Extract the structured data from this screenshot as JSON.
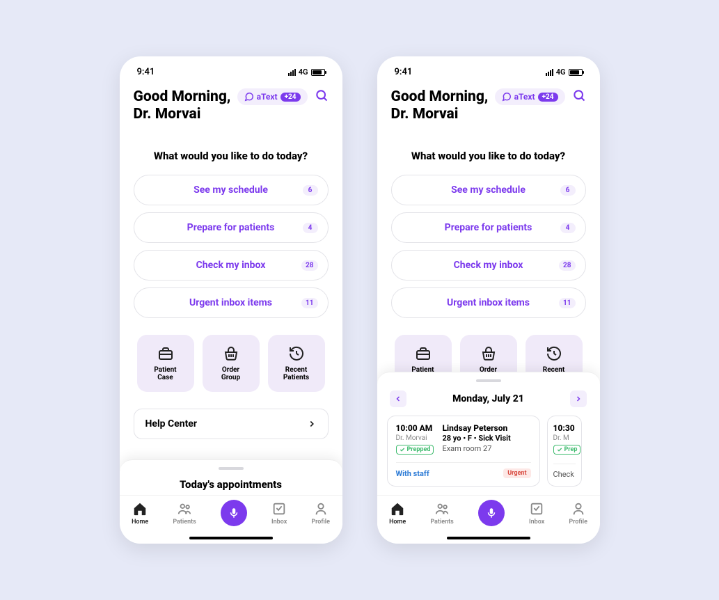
{
  "status": {
    "time": "9:41",
    "network": "4G"
  },
  "header": {
    "greeting_line1": "Good Morning,",
    "greeting_line2": "Dr. Morvai",
    "atext_label": "aText",
    "atext_count": "+24"
  },
  "prompt": "What would you like to do today?",
  "actions": [
    {
      "label": "See my schedule",
      "badge": "6"
    },
    {
      "label": "Prepare for patients",
      "badge": "4"
    },
    {
      "label": "Check my inbox",
      "badge": "28"
    },
    {
      "label": "Urgent inbox items",
      "badge": "11"
    }
  ],
  "tiles": [
    {
      "label": "Patient\nCase"
    },
    {
      "label": "Order\nGroup"
    },
    {
      "label": "Recent\nPatients"
    }
  ],
  "help_label": "Help Center",
  "drawer_collapsed_title": "Today's appointments",
  "drawer": {
    "date": "Monday, July 21",
    "card": {
      "time": "10:00 AM",
      "doctor": "Dr. Morvai",
      "prepped": "Prepped",
      "name": "Lindsay Peterson",
      "sub": "28 yo • F • Sick Visit",
      "room": "Exam room 27",
      "status": "With staff",
      "urgent": "Urgent"
    },
    "peek": {
      "time": "10:30",
      "doctor": "Dr. M",
      "prepped": "Prep",
      "status": "Check"
    }
  },
  "nav": {
    "home": "Home",
    "patients": "Patients",
    "inbox": "Inbox",
    "profile": "Profile"
  }
}
